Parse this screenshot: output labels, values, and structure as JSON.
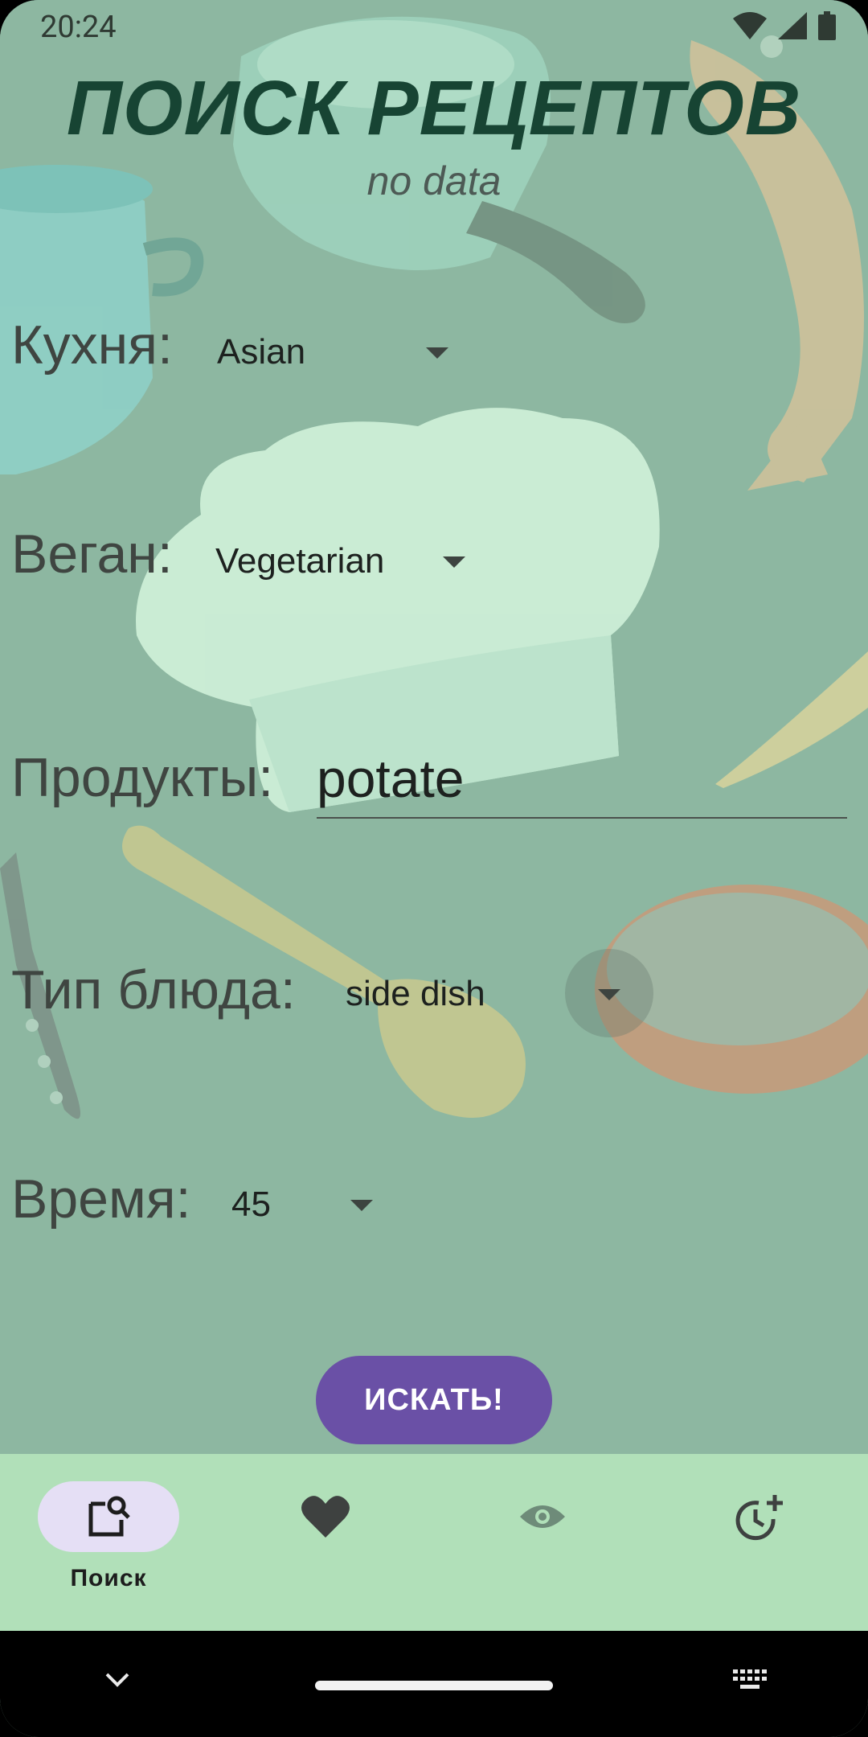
{
  "status_bar": {
    "time": "20:24",
    "icons": [
      "wifi-icon",
      "signal-icon",
      "battery-icon"
    ]
  },
  "header": {
    "title": "ПОИСК РЕЦЕПТОВ",
    "subtitle": "no data"
  },
  "form": {
    "cuisine": {
      "label": "Кухня:",
      "value": "Asian"
    },
    "vegan": {
      "label": "Веган:",
      "value": "Vegetarian"
    },
    "products": {
      "label": "Продукты:",
      "value": "potate"
    },
    "dish_type": {
      "label": "Тип блюда:",
      "value": "side dish"
    },
    "time": {
      "label": "Время:",
      "value": "45"
    },
    "search_button": "ИСКАТЬ!"
  },
  "bottom_nav": {
    "items": [
      {
        "icon": "image-search-icon",
        "label": "Поиск",
        "active": true
      },
      {
        "icon": "heart-icon",
        "active": false
      },
      {
        "icon": "eye-icon",
        "active": false
      },
      {
        "icon": "history-add-icon",
        "active": false
      }
    ]
  },
  "system_nav": {
    "icons": [
      "chevron-down-icon",
      "keyboard-icon"
    ]
  },
  "colors": {
    "background": "#8db7a1",
    "title": "#174433",
    "accent": "#6a50a6",
    "nav_bar": "#b1e0b9",
    "active_pill": "#e5dff5"
  }
}
